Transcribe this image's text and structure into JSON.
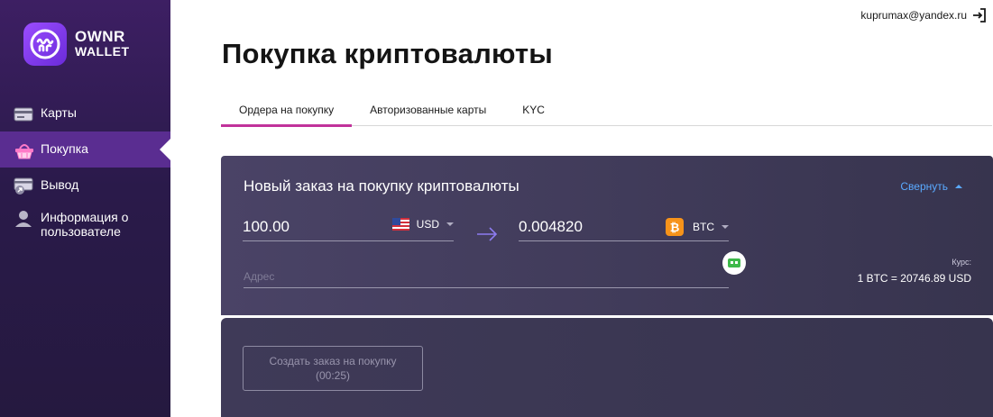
{
  "app": {
    "logo_line1": "OWNR",
    "logo_line2": "WALLET"
  },
  "colors": {
    "sidebar": "#2a1a4a",
    "sidebar_active": "#5a2d91",
    "accent": "#c1329b",
    "link": "#5aaaff",
    "card": "#433e5d",
    "btc": "#f7931a"
  },
  "sidebar": {
    "items": [
      {
        "label": "Карты",
        "icon": "card-icon",
        "active": false
      },
      {
        "label": "Покупка",
        "icon": "basket-icon",
        "active": true
      },
      {
        "label": "Вывод",
        "icon": "withdraw-icon",
        "active": false
      },
      {
        "label": "Информация о пользователе",
        "icon": "user-icon",
        "active": false
      }
    ]
  },
  "header": {
    "user_email": "kuprumax@yandex.ru",
    "logout_icon": "logout-icon"
  },
  "page": {
    "title": "Покупка криптовалюты",
    "tabs": [
      {
        "label": "Ордера на покупку",
        "active": true
      },
      {
        "label": "Авторизованные карты",
        "active": false
      },
      {
        "label": "KYC",
        "active": false
      }
    ]
  },
  "order": {
    "title": "Новый заказ на покупку криптовалюты",
    "collapse_label": "Свернуть",
    "from_amount": "100.00",
    "from_currency": "USD",
    "to_amount": "0.004820",
    "to_currency": "BTC",
    "address_placeholder": "Адрес",
    "rate_label": "Курс:",
    "rate_value": "1 BTC = 20746.89 USD",
    "create_button_line1": "Создать заказ на покупку",
    "create_button_line2": "(00:25)"
  }
}
